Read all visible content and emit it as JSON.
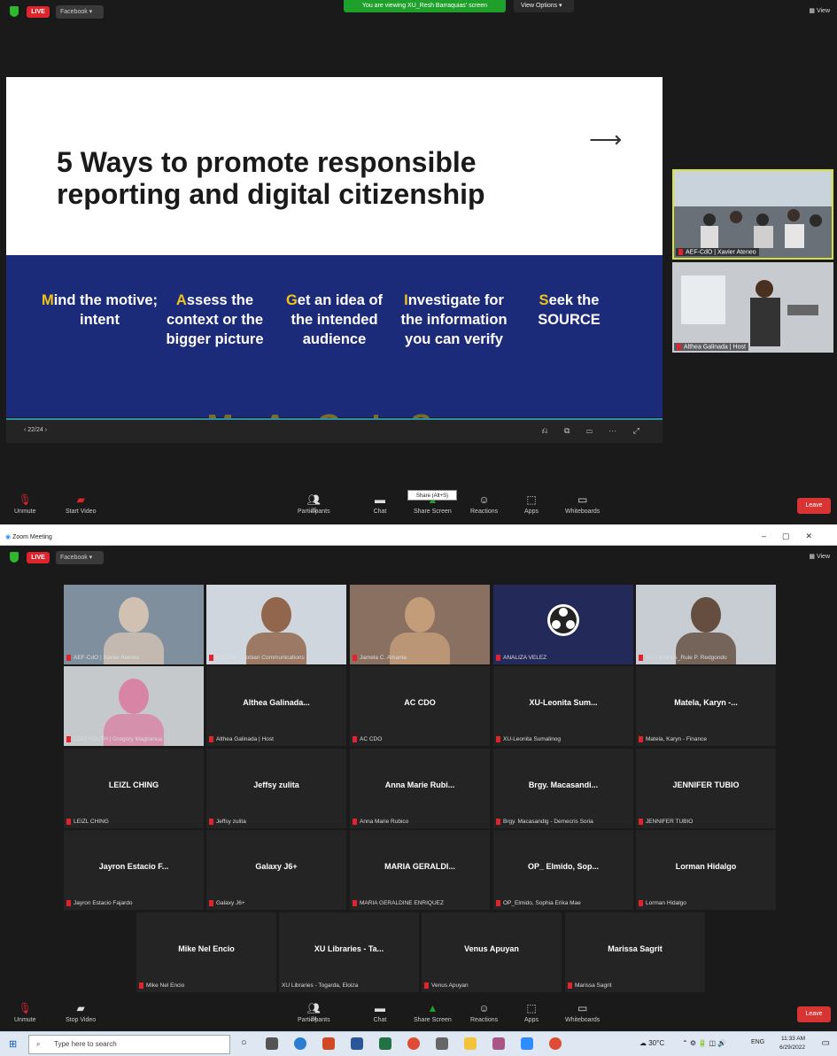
{
  "top_window": {
    "live_badge": "LIVE",
    "facebook_menu": "Facebook ▾",
    "viewing_banner": "You are viewing XU_Resh Barraquias' screen",
    "view_options": "View Options ▾",
    "view_button": "View",
    "slide": {
      "title": "5 Ways to promote responsible reporting and digital citizenship",
      "arrow": "⟶",
      "columns": [
        {
          "first": "M",
          "rest": "ind the motive; intent"
        },
        {
          "first": "A",
          "rest": "ssess the context or the bigger picture"
        },
        {
          "first": "G",
          "rest": "et an idea of the intended audience"
        },
        {
          "first": "I",
          "rest": "nvestigate for the information you can verify"
        },
        {
          "first": "S",
          "rest": "eek the SOURCE"
        }
      ],
      "watermark": "MAGIS",
      "page_indicator": "‹  22/24  ›",
      "controls": "⎌ ⧉ ▭ ⋯ ⤢"
    },
    "thumbnails": [
      {
        "name": "AEF-CdO | Xavier Ateneo"
      },
      {
        "name": "Althea Galinada | Host"
      }
    ],
    "toolbar": {
      "unmute": "Unmute",
      "start_video": "Start Video",
      "participants": "Participants",
      "participants_count": "25",
      "chat": "Chat",
      "share_screen": "Share Screen",
      "reactions": "Reactions",
      "apps": "Apps",
      "whiteboards": "Whiteboards",
      "leave": "Leave",
      "share_tooltip": "Share (Alt+S)"
    }
  },
  "window_title": "Zoom Meeting",
  "bottom_window": {
    "live_badge": "LIVE",
    "facebook_menu": "Facebook ▾",
    "view_button": "View",
    "tiles": [
      {
        "big": "",
        "name": "AEF-CdO | Xavier Ateneo",
        "video": true
      },
      {
        "big": "",
        "name": "Capillan_Globian Communications ...",
        "video": true
      },
      {
        "big": "",
        "name": "Jamela C. Amante",
        "video": true
      },
      {
        "big": "",
        "name": "ANALIZA VELEZ",
        "video": true
      },
      {
        "big": "",
        "name": "XU Libraries_Rule P. Redgondo",
        "video": true
      },
      {
        "big": "",
        "name": "CDO YOUTH | Gregory Magbanua",
        "video": true
      },
      {
        "big": "Althea Galinada...",
        "name": "Althea Galinada | Host"
      },
      {
        "big": "AC CDO",
        "name": "AC CDO"
      },
      {
        "big": "XU-Leonita Sum...",
        "name": "XU-Leonita Sumalinog"
      },
      {
        "big": "Matela, Karyn -...",
        "name": "Matela, Karyn - Finance"
      },
      {
        "big": "LEIZL CHING",
        "name": "LEIZL CHING"
      },
      {
        "big": "Jeffsy zulita",
        "name": "Jeffsy zulita"
      },
      {
        "big": "Anna Marie Rubi...",
        "name": "Anna Marie Rubico"
      },
      {
        "big": "Brgy. Macasandi...",
        "name": "Brgy. Macasandig - Demecris Soria"
      },
      {
        "big": "JENNIFER TUBIO",
        "name": "JENNIFER TUBIO"
      },
      {
        "big": "Jayron Estacio F...",
        "name": "Jayron Estacio Fajardo"
      },
      {
        "big": "Galaxy J6+",
        "name": "Galaxy J6+"
      },
      {
        "big": "MARIA GERALDI...",
        "name": "MARIA GERALDINE ENRIQUEZ"
      },
      {
        "big": "OP_ Elmido, Sop...",
        "name": "OP_Elmido, Sophia Erika Mae"
      },
      {
        "big": "Lorman Hidalgo",
        "name": "Lorman Hidalgo"
      },
      {
        "big": "Mike Nel Encio",
        "name": "Mike Nel Encio"
      },
      {
        "big": "XU Libraries - Ta...",
        "name": "XU Libraries - Togarda, Eloiza"
      },
      {
        "big": "Venus Apuyan",
        "name": "Venus Apuyan"
      },
      {
        "big": "Marissa Sagrit",
        "name": "Marissa Sagrit"
      }
    ],
    "toolbar": {
      "unmute": "Unmute",
      "stop_video": "Stop Video",
      "participants": "Participants",
      "participants_count": "24",
      "chat": "Chat",
      "share_screen": "Share Screen",
      "reactions": "Reactions",
      "apps": "Apps",
      "whiteboards": "Whiteboards",
      "leave": "Leave"
    }
  },
  "taskbar": {
    "search_placeholder": "Type here to search",
    "weather": "30°C",
    "lang": "ENG",
    "time": "11:33 AM",
    "date": "6/29/2022"
  },
  "colors": {
    "live": "#e0242d",
    "banner": "#1fa02a",
    "slide_blue": "#1c2b79",
    "accent_letter": "#f0c419",
    "leave": "#d73434"
  }
}
